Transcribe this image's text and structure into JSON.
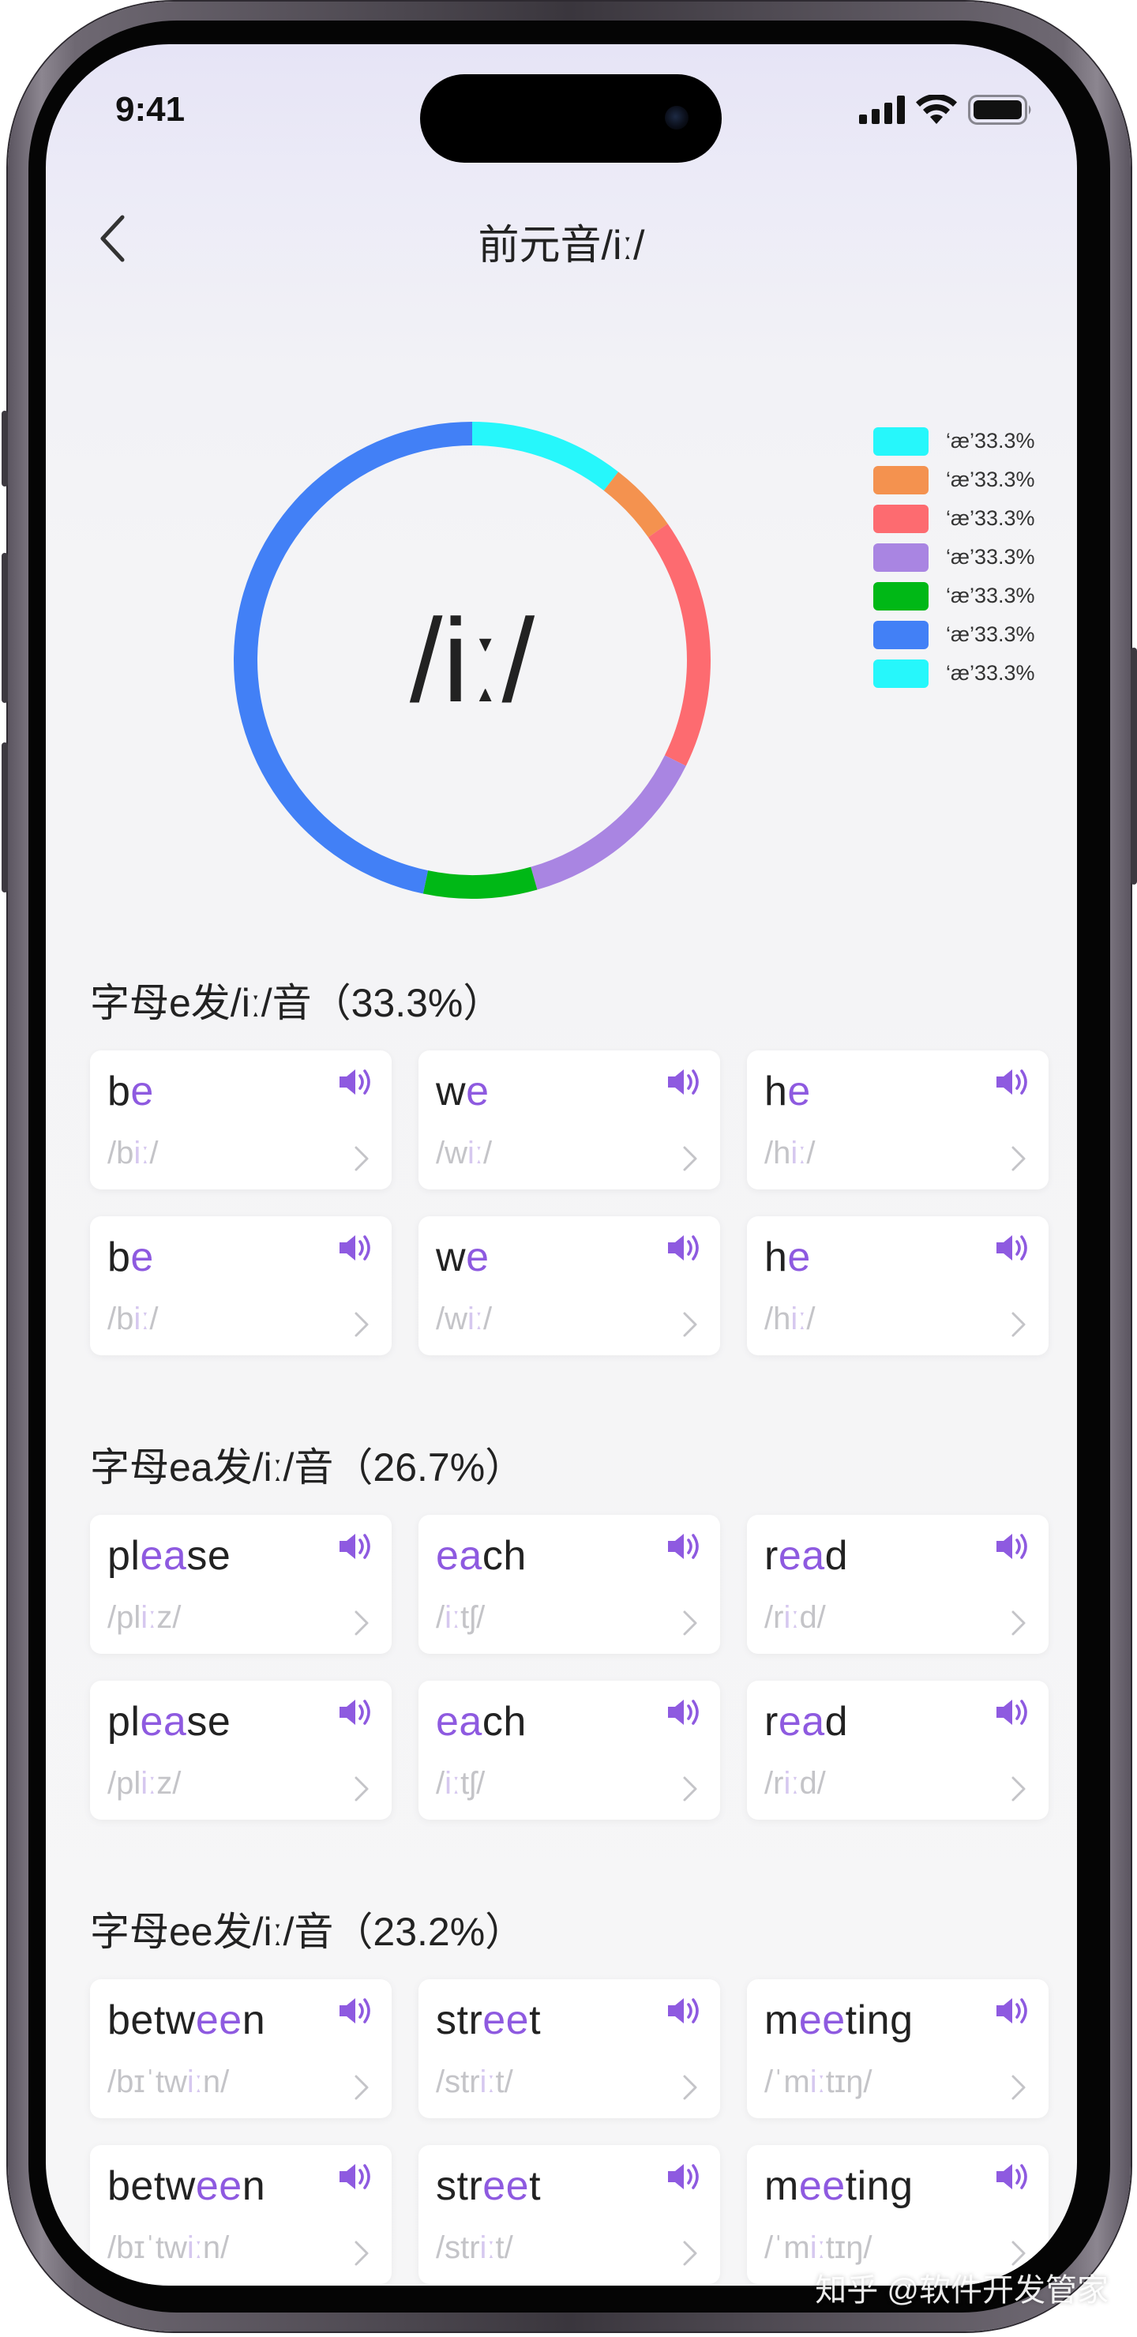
{
  "status": {
    "time": "9:41"
  },
  "header": {
    "title": "前元音/iː/"
  },
  "chart_data": {
    "type": "pie",
    "center_label": "/iː/",
    "slices": [
      {
        "color": "#26f7fb",
        "value": 10.5
      },
      {
        "color": "#f4924f",
        "value": 4.8
      },
      {
        "color": "#fd6b70",
        "value": 17.0
      },
      {
        "color": "#a985e2",
        "value": 13.3
      },
      {
        "color": "#00b816",
        "value": 7.7
      },
      {
        "color": "#4280f6",
        "value": 46.7
      }
    ],
    "legend": [
      {
        "color": "#26f7fb",
        "label": "‘æ’33.3%"
      },
      {
        "color": "#f4924f",
        "label": "‘æ’33.3%"
      },
      {
        "color": "#fd6b70",
        "label": "‘æ’33.3%"
      },
      {
        "color": "#a985e2",
        "label": "‘æ’33.3%"
      },
      {
        "color": "#00b816",
        "label": "‘æ’33.3%"
      },
      {
        "color": "#4280f6",
        "label": "‘æ’33.3%"
      },
      {
        "color": "#26f7fb",
        "label": "‘æ’33.3%"
      }
    ]
  },
  "colors": {
    "accent": "#8e5ae0",
    "text": "#222222",
    "muted": "#c4c4c8"
  },
  "sections": [
    {
      "title": "字母e发/iː/音（33.3%）",
      "cards": [
        {
          "word": [
            [
              "b",
              false
            ],
            [
              "e",
              true
            ]
          ],
          "phonetic": [
            [
              "/b",
              false
            ],
            [
              "iː",
              true
            ],
            [
              "/",
              false
            ]
          ]
        },
        {
          "word": [
            [
              "w",
              false
            ],
            [
              "e",
              true
            ]
          ],
          "phonetic": [
            [
              "/w",
              false
            ],
            [
              "iː",
              true
            ],
            [
              "/",
              false
            ]
          ]
        },
        {
          "word": [
            [
              "h",
              false
            ],
            [
              "e",
              true
            ]
          ],
          "phonetic": [
            [
              "/h",
              false
            ],
            [
              "iː",
              true
            ],
            [
              "/",
              false
            ]
          ]
        },
        {
          "word": [
            [
              "b",
              false
            ],
            [
              "e",
              true
            ]
          ],
          "phonetic": [
            [
              "/b",
              false
            ],
            [
              "iː",
              true
            ],
            [
              "/",
              false
            ]
          ]
        },
        {
          "word": [
            [
              "w",
              false
            ],
            [
              "e",
              true
            ]
          ],
          "phonetic": [
            [
              "/w",
              false
            ],
            [
              "iː",
              true
            ],
            [
              "/",
              false
            ]
          ]
        },
        {
          "word": [
            [
              "h",
              false
            ],
            [
              "e",
              true
            ]
          ],
          "phonetic": [
            [
              "/h",
              false
            ],
            [
              "iː",
              true
            ],
            [
              "/",
              false
            ]
          ]
        }
      ]
    },
    {
      "title": "字母ea发/iː/音（26.7%）",
      "cards": [
        {
          "word": [
            [
              "pl",
              false
            ],
            [
              "ea",
              true
            ],
            [
              "se",
              false
            ]
          ],
          "phonetic": [
            [
              "/pl",
              false
            ],
            [
              "iː",
              true
            ],
            [
              "z/",
              false
            ]
          ]
        },
        {
          "word": [
            [
              "ea",
              true
            ],
            [
              "ch",
              false
            ]
          ],
          "phonetic": [
            [
              "/",
              false
            ],
            [
              "iː",
              true
            ],
            [
              "tʃ/",
              false
            ]
          ]
        },
        {
          "word": [
            [
              "r",
              false
            ],
            [
              "ea",
              true
            ],
            [
              "d",
              false
            ]
          ],
          "phonetic": [
            [
              "/r",
              false
            ],
            [
              "iː",
              true
            ],
            [
              "d/",
              false
            ]
          ]
        },
        {
          "word": [
            [
              "pl",
              false
            ],
            [
              "ea",
              true
            ],
            [
              "se",
              false
            ]
          ],
          "phonetic": [
            [
              "/pl",
              false
            ],
            [
              "iː",
              true
            ],
            [
              "z/",
              false
            ]
          ]
        },
        {
          "word": [
            [
              "ea",
              true
            ],
            [
              "ch",
              false
            ]
          ],
          "phonetic": [
            [
              "/",
              false
            ],
            [
              "iː",
              true
            ],
            [
              "tʃ/",
              false
            ]
          ]
        },
        {
          "word": [
            [
              "r",
              false
            ],
            [
              "ea",
              true
            ],
            [
              "d",
              false
            ]
          ],
          "phonetic": [
            [
              "/r",
              false
            ],
            [
              "iː",
              true
            ],
            [
              "d/",
              false
            ]
          ]
        }
      ]
    },
    {
      "title": "字母ee发/iː/音（23.2%）",
      "cards": [
        {
          "word": [
            [
              "betw",
              false
            ],
            [
              "ee",
              true
            ],
            [
              "n",
              false
            ]
          ],
          "phonetic": [
            [
              "/bɪˈtw",
              false
            ],
            [
              "iː",
              true
            ],
            [
              "n/",
              false
            ]
          ]
        },
        {
          "word": [
            [
              "str",
              false
            ],
            [
              "ee",
              true
            ],
            [
              "t",
              false
            ]
          ],
          "phonetic": [
            [
              "/str",
              false
            ],
            [
              "iː",
              true
            ],
            [
              "t/",
              false
            ]
          ]
        },
        {
          "word": [
            [
              "m",
              false
            ],
            [
              "ee",
              true
            ],
            [
              "ting",
              false
            ]
          ],
          "phonetic": [
            [
              "/ˈm",
              false
            ],
            [
              "iː",
              true
            ],
            [
              "tɪŋ/",
              false
            ]
          ]
        },
        {
          "word": [
            [
              "betw",
              false
            ],
            [
              "ee",
              true
            ],
            [
              "n",
              false
            ]
          ],
          "phonetic": [
            [
              "/bɪˈtw",
              false
            ],
            [
              "iː",
              true
            ],
            [
              "n/",
              false
            ]
          ]
        },
        {
          "word": [
            [
              "str",
              false
            ],
            [
              "ee",
              true
            ],
            [
              "t",
              false
            ]
          ],
          "phonetic": [
            [
              "/str",
              false
            ],
            [
              "iː",
              true
            ],
            [
              "t/",
              false
            ]
          ]
        },
        {
          "word": [
            [
              "m",
              false
            ],
            [
              "ee",
              true
            ],
            [
              "ting",
              false
            ]
          ],
          "phonetic": [
            [
              "/ˈm",
              false
            ],
            [
              "iː",
              true
            ],
            [
              "tɪŋ/",
              false
            ]
          ]
        }
      ]
    }
  ],
  "watermark": "知乎 @软件开发管家"
}
